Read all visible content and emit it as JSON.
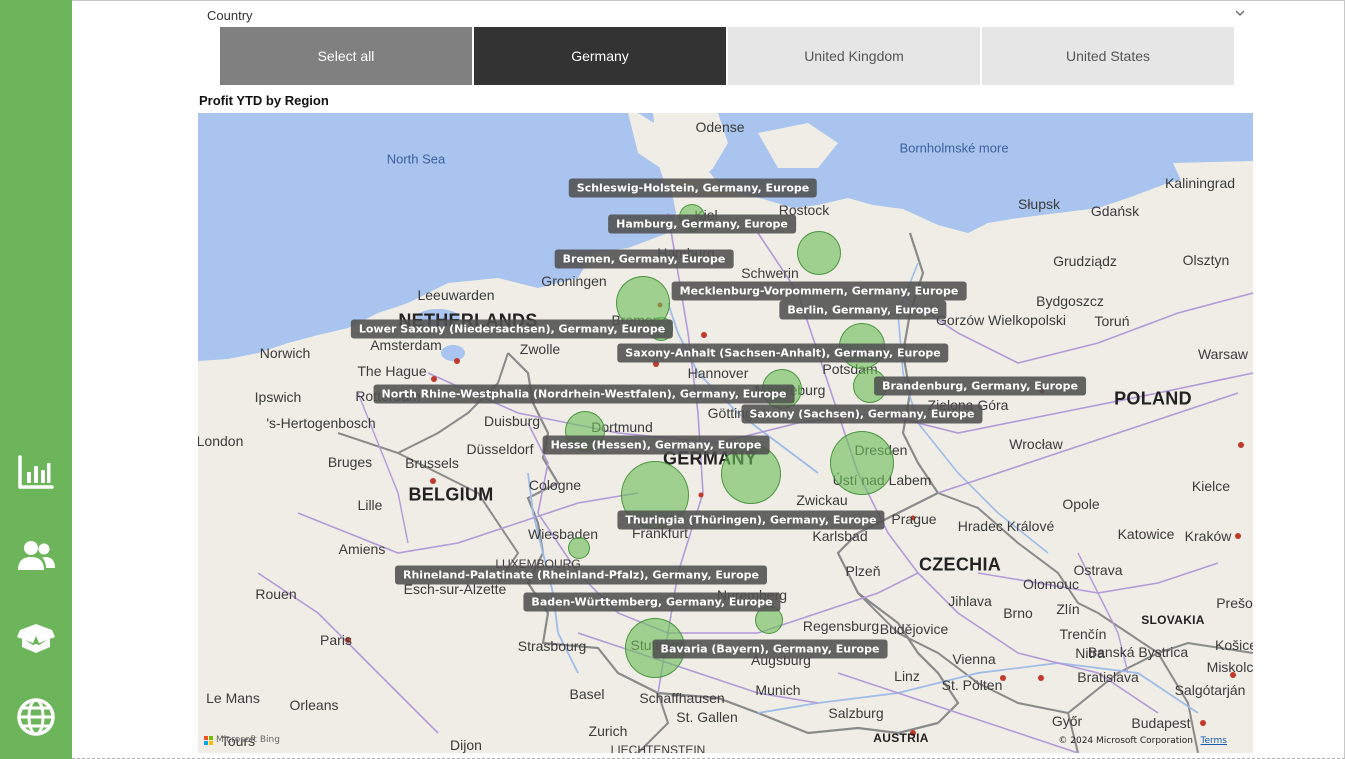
{
  "nav": {
    "items": [
      {
        "icon": "bar-chart-icon"
      },
      {
        "icon": "users-icon"
      },
      {
        "icon": "box-icon"
      },
      {
        "icon": "globe-icon"
      }
    ],
    "rail_color": "#6db55b"
  },
  "slicer": {
    "header": "Country",
    "tiles": [
      {
        "label": "Select all",
        "state": "select-all"
      },
      {
        "label": "Germany",
        "state": "selected"
      },
      {
        "label": "United Kingdom",
        "state": "normal"
      },
      {
        "label": "United States",
        "state": "normal"
      }
    ]
  },
  "visual": {
    "title": "Profit YTD by Region"
  },
  "map": {
    "water_labels": [
      "North Sea",
      "Bornholmské more"
    ],
    "country_labels": [
      "NETHERLANDS",
      "BELGIUM",
      "GERMANY",
      "POLAND",
      "CZECHIA",
      "SLOVAKIA",
      "AUSTRIA",
      "LUXEMBOURG",
      "LIECHTENSTEIN"
    ],
    "city_labels": [
      "Odense",
      "Kaliningrad",
      "Słupsk",
      "Gdańsk",
      "Rostock",
      "Kiel",
      "Hamburg",
      "Schwerin",
      "Grudziądz",
      "Olsztyn",
      "Groningen",
      "Leeuwarden",
      "Bremen",
      "Bydgoszcz",
      "Toruń",
      "Amsterdam",
      "Norwich",
      "Zwolle",
      "Gorzów Wielkopolski",
      "Warsaw",
      "The Hague",
      "Rotterdam",
      "Hannover",
      "Potsdam",
      "Ipswich",
      "Magdeburg",
      "Göttingen",
      "Zielona Góra",
      "'s-Hertogenbosch",
      "Duisburg",
      "Dortmund",
      "London",
      "Düsseldorf",
      "Wrocław",
      "Bruges",
      "Brussels",
      "Dresden",
      "Kielce",
      "Cologne",
      "Ústí nad Labem",
      "Lille",
      "Zwickau",
      "Opole",
      "Wiesbaden",
      "Frankfurt",
      "Prague",
      "Hradec Králové",
      "Katowice",
      "Kraków",
      "Amiens",
      "Karlsbad",
      "Plzeň",
      "Ostrava",
      "Rouen",
      "Esch-sur-Alzette",
      "Nuremberg",
      "Olomouc",
      "Jihlava",
      "Paris",
      "Strasbourg",
      "Regensburg",
      "Brno",
      "Zlín",
      "Trenčín",
      "Prešov",
      "Budějovice",
      "Banská Bystrica",
      "Košice",
      "Augsburg",
      "Nitra",
      "Miskolc",
      "Stuttgart",
      "Le Mans",
      "Munich",
      "Linz",
      "Vienna",
      "Bratislava",
      "Salgótarján",
      "Orleans",
      "Basel",
      "Schaffhausen",
      "St. Pölten",
      "Tours",
      "Zurich",
      "St. Gallen",
      "Salzburg",
      "Győr",
      "Budapest",
      "Dijon"
    ],
    "copyright": "© 2024 Microsoft Corporation",
    "terms": "Terms",
    "attribution": "Microsoft Bing"
  },
  "chart_data": {
    "type": "scatter",
    "title": "Profit YTD by Region",
    "series": [
      {
        "values": [
          {
            "region": "Schleswig-Holstein, Germany, Europe"
          },
          {
            "region": "Hamburg, Germany, Europe"
          },
          {
            "region": "Bremen, Germany, Europe"
          },
          {
            "region": "Mecklenburg-Vorpommern, Germany, Europe"
          },
          {
            "region": "Berlin, Germany, Europe"
          },
          {
            "region": "Lower Saxony (Niedersachsen), Germany, Europe"
          },
          {
            "region": "Saxony-Anhalt (Sachsen-Anhalt), Germany, Europe"
          },
          {
            "region": "Brandenburg, Germany, Europe"
          },
          {
            "region": "North Rhine-Westphalia (Nordrhein-Westfalen), Germany, Europe"
          },
          {
            "region": "Saxony (Sachsen), Germany, Europe"
          },
          {
            "region": "Hesse (Hessen), Germany, Europe"
          },
          {
            "region": "Thuringia (Thüringen), Germany, Europe"
          },
          {
            "region": "Rhineland-Palatinate (Rheinland-Pfalz), Germany, Europe"
          },
          {
            "region": "Baden-Württemberg, Germany, Europe"
          },
          {
            "region": "Bavaria (Bayern), Germany, Europe"
          }
        ]
      }
    ],
    "bubble_color": "#6ebe5a"
  }
}
